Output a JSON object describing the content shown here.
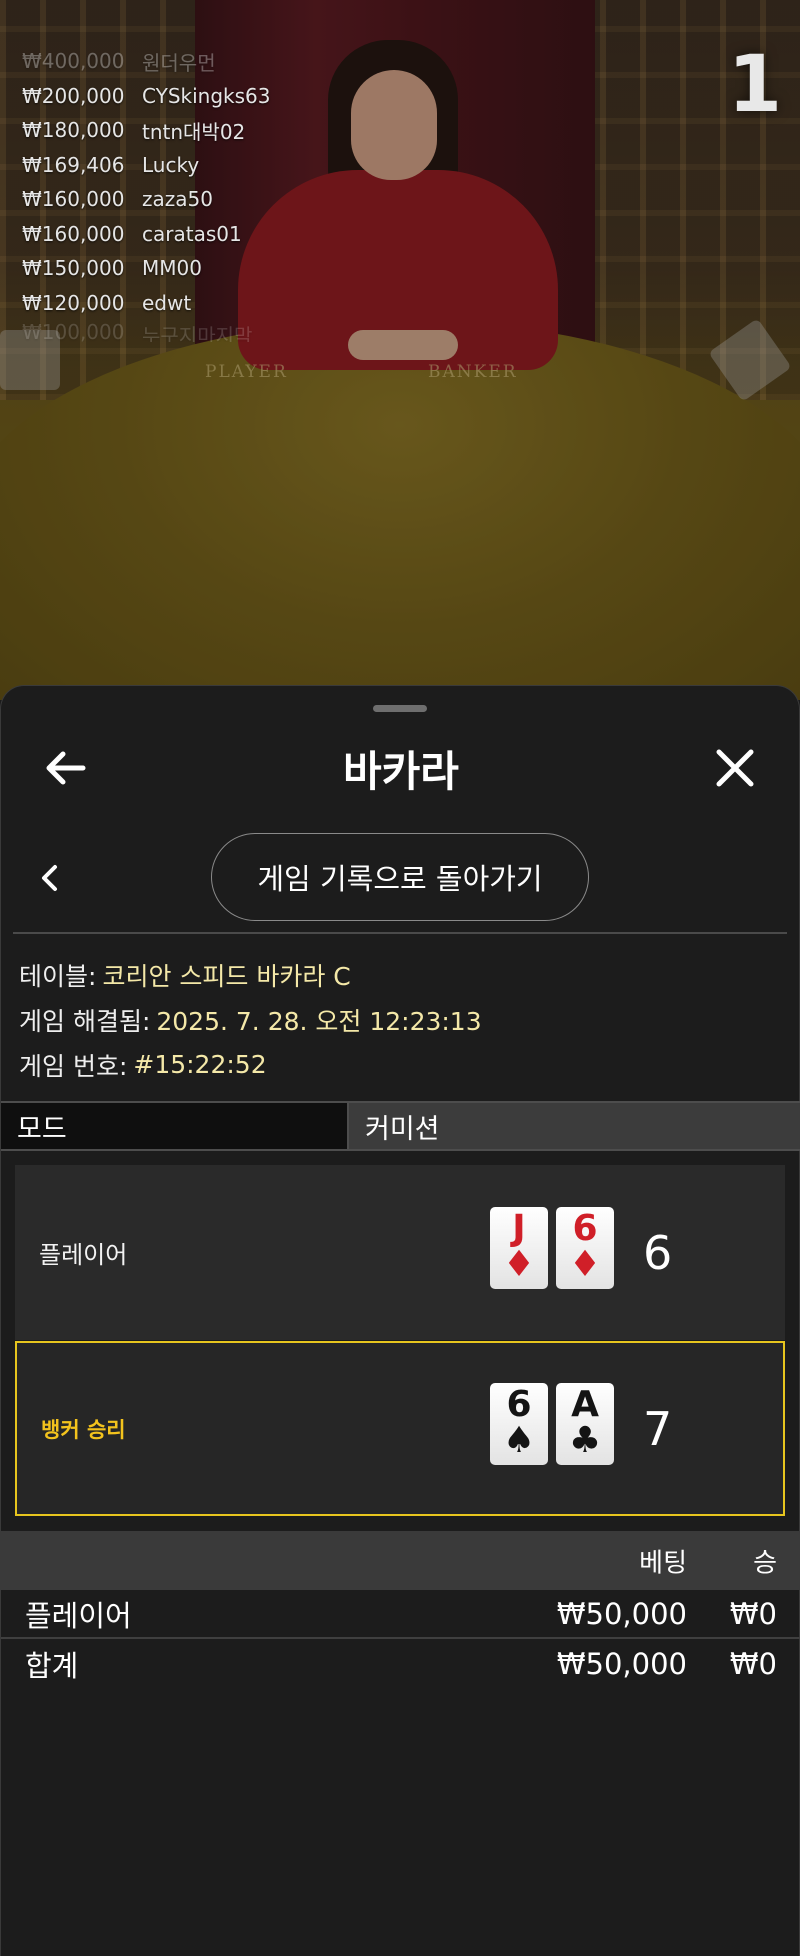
{
  "video": {
    "round_number": "1",
    "felt_left": "PLAYER",
    "felt_right": "BANKER",
    "winners": [
      {
        "amount": "₩400,000",
        "name": "원더우먼"
      },
      {
        "amount": "₩200,000",
        "name": "CYSkingks63"
      },
      {
        "amount": "₩180,000",
        "name": "tntn대박02"
      },
      {
        "amount": "₩169,406",
        "name": "Lucky"
      },
      {
        "amount": "₩160,000",
        "name": "zaza50"
      },
      {
        "amount": "₩160,000",
        "name": "caratas01"
      },
      {
        "amount": "₩150,000",
        "name": "MM00"
      },
      {
        "amount": "₩120,000",
        "name": "edwt"
      },
      {
        "amount": "₩100,000",
        "name": "누구지마지막"
      }
    ]
  },
  "header": {
    "title": "바카라",
    "back_icon": "arrow-left-icon",
    "close_icon": "close-icon"
  },
  "nav": {
    "history_button": "게임 기록으로 돌아가기",
    "prev_icon": "chevron-left-icon"
  },
  "info": {
    "table_label": "테이블:",
    "table_value": "코리안 스피드 바카라 C",
    "resolved_label": "게임 해결됨:",
    "resolved_value": "2025. 7. 28. 오전 12:23:13",
    "game_no_label": "게임 번호:",
    "game_no_value": "#15:22:52"
  },
  "tabs": {
    "mode": "모드",
    "commission": "커미션"
  },
  "results": {
    "player": {
      "label": "플레이어",
      "cards": [
        {
          "rank": "J",
          "suit": "♦",
          "color": "red"
        },
        {
          "rank": "6",
          "suit": "♦",
          "color": "red"
        }
      ],
      "score": "6"
    },
    "banker": {
      "label": "뱅커 승리",
      "cards": [
        {
          "rank": "6",
          "suit": "♠",
          "color": "black"
        },
        {
          "rank": "A",
          "suit": "♣",
          "color": "black"
        }
      ],
      "score": "7"
    }
  },
  "bets": {
    "header": {
      "bet": "베팅",
      "win": "승"
    },
    "rows": [
      {
        "name": "플레이어",
        "bet": "₩50,000",
        "win": "₩0"
      }
    ],
    "total": {
      "name": "합계",
      "bet": "₩50,000",
      "win": "₩0"
    }
  },
  "colors": {
    "accent_yellow": "#e7c51e",
    "info_value": "#f4e8a8",
    "sheet_bg": "#1c1c1c",
    "card_red": "#d01f28"
  }
}
